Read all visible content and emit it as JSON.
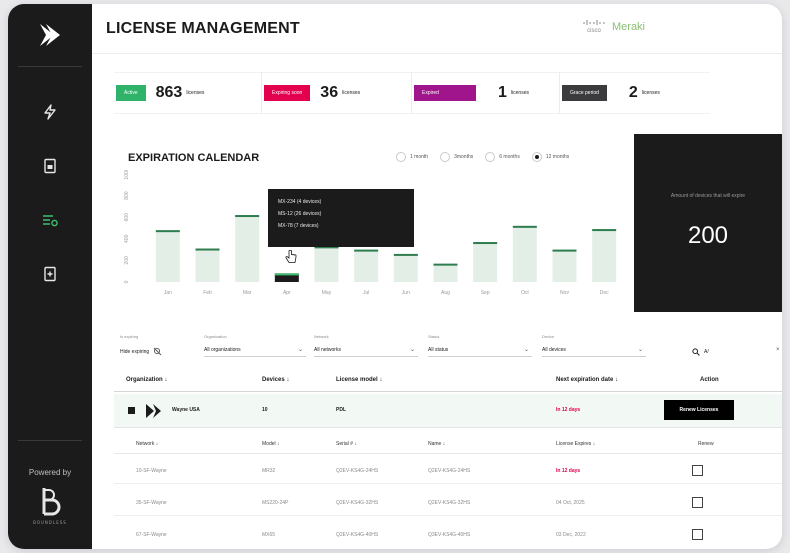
{
  "sidebar": {
    "powered_by": "Powered by",
    "boundless_label": "BOUNDLESS"
  },
  "header": {
    "title": "LICENSE MANAGEMENT",
    "brand_small": "cisco",
    "brand": "Meraki"
  },
  "stats": [
    {
      "badge": "Active",
      "value": "863",
      "unit": "licenses",
      "color": "#2fb36a"
    },
    {
      "badge": "Expiring soon",
      "value": "36",
      "unit": "licenses",
      "color": "#e3004f"
    },
    {
      "badge": "Expired",
      "value": "1",
      "unit": "licenses",
      "color": "#a0158c"
    },
    {
      "badge": "Grace period",
      "value": "2",
      "unit": "licenses",
      "color": "#3b3b3d"
    }
  ],
  "calendar": {
    "title": "EXPIRATION CALENDAR",
    "options": [
      "1 month",
      "3months",
      "6 months",
      "12 months"
    ],
    "selected": "12 months"
  },
  "chart_data": {
    "type": "bar",
    "categories": [
      "Jan",
      "Feb",
      "Mar",
      "Apr",
      "May",
      "Jul",
      "Jun",
      "Aug",
      "Sep",
      "Oct",
      "Nov",
      "Dec"
    ],
    "values": [
      480,
      310,
      620,
      80,
      330,
      300,
      260,
      170,
      370,
      520,
      300,
      490
    ],
    "highlight_index": 3,
    "ytick_labels": [
      "1000",
      "800",
      "600",
      "400",
      "200",
      "0"
    ],
    "ylim": [
      0,
      1000
    ],
    "colors": {
      "bar": "#e3efe6",
      "bar_top": "#2e7d4f",
      "highlight": "#1b1b1c"
    }
  },
  "tooltip": {
    "lines": [
      "MX-234 (4 devices)",
      "MS-12 (26 devices)",
      "MX-78 (7 devices)"
    ]
  },
  "amount": {
    "label": "Amount of devices that will expire",
    "value": "200"
  },
  "filters": {
    "is_expiring": {
      "caption": "Is expiring",
      "value": "Hide expiring"
    },
    "organization": {
      "caption": "Organization",
      "value": "All organizations"
    },
    "network": {
      "caption": "Network",
      "value": "All networks"
    },
    "status": {
      "caption": "Status",
      "value": "All status"
    },
    "device": {
      "caption": "Device",
      "value": "All devices"
    },
    "search": {
      "value": "A/"
    }
  },
  "table": {
    "headers": {
      "organization": "Organization",
      "devices": "Devices",
      "license_model": "License model",
      "next_expiration": "Next expiration date",
      "action": "Action"
    },
    "org_row": {
      "name": "Wayne USA",
      "devices": "10",
      "model": "PDL",
      "expiration": "In 12 days",
      "action": "Renew Licenses"
    },
    "sub_headers": {
      "network": "Network",
      "model": "Model",
      "serial": "Serial #",
      "name": "Name",
      "expires": "License Expires",
      "renew": "Renew"
    },
    "sub_rows": [
      {
        "network": "10-SF-Wayne",
        "model": "MR32",
        "serial": "Q2EV-KS4G-24HS",
        "name": "Q2EV-KS4G-24HS",
        "expires": "In 12 days"
      },
      {
        "network": "35-SF-Wayne",
        "model": "MS220-24P",
        "serial": "Q2EV-KS4G-32HS",
        "name": "Q2EV-KS4G-32HS",
        "expires": "04 Oct, 2025"
      },
      {
        "network": "67-SF-Wayne",
        "model": "MX65",
        "serial": "Q2EV-KS4G-40HS",
        "name": "Q3EV-KS4G-40HS",
        "expires": "03 Dec, 2022"
      }
    ]
  }
}
